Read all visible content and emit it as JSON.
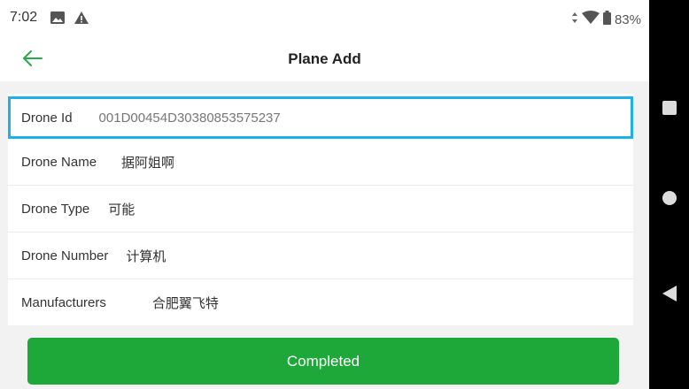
{
  "status_bar": {
    "time": "7:02",
    "battery": "83%",
    "icons": [
      "image-icon",
      "warning-icon",
      "data-arrows-icon",
      "wifi-icon",
      "battery-icon"
    ]
  },
  "header": {
    "title": "Plane Add",
    "back_icon": "back-arrow-icon"
  },
  "form": {
    "fields": [
      {
        "label": "Drone Id",
        "value": "001D00454D30380853575237"
      },
      {
        "label": "Drone Name",
        "value": "据阿姐啊"
      },
      {
        "label": "Drone Type",
        "value": "可能"
      },
      {
        "label": "Drone Number",
        "value": "计算机"
      },
      {
        "label": "Manufacturers",
        "value": "合肥翼飞特"
      }
    ]
  },
  "actions": {
    "completed_label": "Completed"
  },
  "colors": {
    "accent_green": "#1ea83a",
    "focus_blue": "#20b0e8",
    "back_arrow": "#2aa84a"
  },
  "system_nav": [
    "recents-square-icon",
    "home-circle-icon",
    "back-triangle-icon"
  ]
}
